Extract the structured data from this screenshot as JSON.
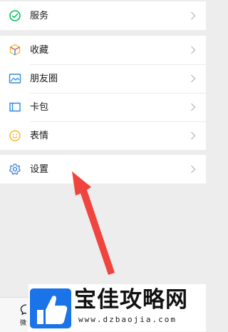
{
  "menu": {
    "groups": [
      {
        "items": [
          {
            "label": "服务",
            "icon": "service-icon"
          }
        ]
      },
      {
        "items": [
          {
            "label": "收藏",
            "icon": "favorites-icon"
          },
          {
            "label": "朋友圈",
            "icon": "moments-icon"
          },
          {
            "label": "卡包",
            "icon": "card-wallet-icon"
          },
          {
            "label": "表情",
            "icon": "sticker-icon"
          }
        ]
      },
      {
        "items": [
          {
            "label": "设置",
            "icon": "settings-icon"
          }
        ]
      }
    ]
  },
  "tabbar": {
    "partial_label": "微"
  },
  "watermark": {
    "title": "宝佳攻略网",
    "url": "www.dzbaojia.com"
  },
  "colors": {
    "background": "#ededed",
    "arrow": "#f0453e",
    "service_green": "#07c160",
    "moments_blue": "#2b8ee0",
    "sticker_yellow": "#f6b93b",
    "settings_blue": "#3a7bd5",
    "logo_blue": "#1a73e8"
  }
}
